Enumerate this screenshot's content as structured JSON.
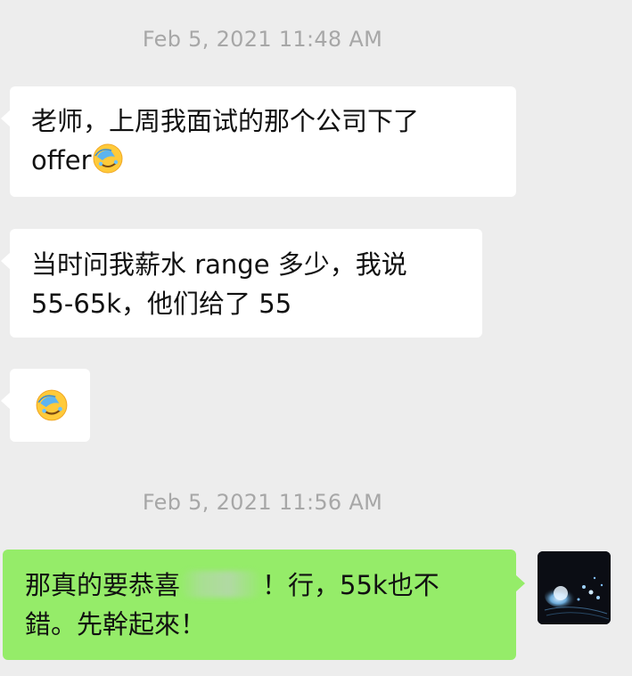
{
  "timestamps": [
    "Feb 5, 2021 11:48 AM",
    "Feb 5, 2021 11:56 AM"
  ],
  "messages": {
    "m1": {
      "line1": "老师，上周我面试的那个公司下了",
      "line2": "offer",
      "emoji": "face-palm-crying-emoji"
    },
    "m2": {
      "line1": "当时问我薪水 range 多少，我说",
      "line2": "55-65k，他们给了 55"
    },
    "m3": {
      "emoji": "face-palm-crying-emoji"
    },
    "m4": {
      "line1_a": "那真的要恭喜",
      "line1_b": "！行，55k也不",
      "line2": "錯。先幹起來！"
    }
  },
  "colors": {
    "background": "#ededed",
    "incoming_bubble": "#ffffff",
    "outgoing_bubble": "#95ec69",
    "timestamp_text": "#a7a7a7"
  }
}
